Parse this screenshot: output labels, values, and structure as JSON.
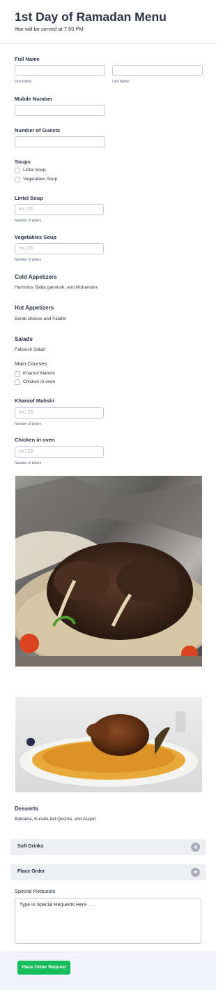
{
  "header": {
    "title": "1st Day of Ramadan Menu",
    "subtitle": "Iftar will be served at 7:50 PM"
  },
  "full_name": {
    "label": "Full Name",
    "first_sub": "First Name",
    "last_sub": "Last Name"
  },
  "mobile": {
    "label": "Mobile Number"
  },
  "guests": {
    "label": "Number of Guests"
  },
  "soups": {
    "label": "Soups",
    "options": [
      "Lintel Soup",
      "Vegetables Soup"
    ]
  },
  "lintel_soup": {
    "label": "Lintel Soup",
    "placeholder": "ex: 23",
    "sub": "Number of plates"
  },
  "veg_soup": {
    "label": "Vegetables Soup",
    "placeholder": "ex: 23",
    "sub": "Number of plates"
  },
  "cold_appetizers": {
    "heading": "Cold Appetizers",
    "text": "Hummus, Baba ganoush, and Muhamara"
  },
  "hot_appetizers": {
    "heading": "Hot Appetizers",
    "text": "Borak cheese and Falafel"
  },
  "salads": {
    "heading": "Salads",
    "text": "Fattoush Salad"
  },
  "main_courses": {
    "label": "Main Courses",
    "options": [
      "Kharoof Mahshi",
      "Chicken in oven"
    ]
  },
  "kharoof": {
    "label": "Kharoof Mahshi",
    "placeholder": "ex: 23",
    "sub": "Number of plates"
  },
  "chicken": {
    "label": "Chicken in oven",
    "placeholder": "ex: 23",
    "sub": "Number of plates"
  },
  "desserts": {
    "heading": "Desserts",
    "text": "Baklawa, Kunafa bel Qeshta, and Atayef"
  },
  "sections": {
    "soft_drinks": "Soft Drinks",
    "place_order": "Place Order"
  },
  "special_requests": {
    "label": "Special Requests",
    "placeholder": "Type in Special Requests Here . . ."
  },
  "submit": {
    "label": "Place Order Request"
  },
  "colors": {
    "accent": "#18bd5b",
    "text": "#2c3345",
    "section_bg": "#eeeff3"
  },
  "icons": {
    "soft_drinks": "chevron-left-circle-icon",
    "place_order": "chevron-down-circle-icon"
  }
}
